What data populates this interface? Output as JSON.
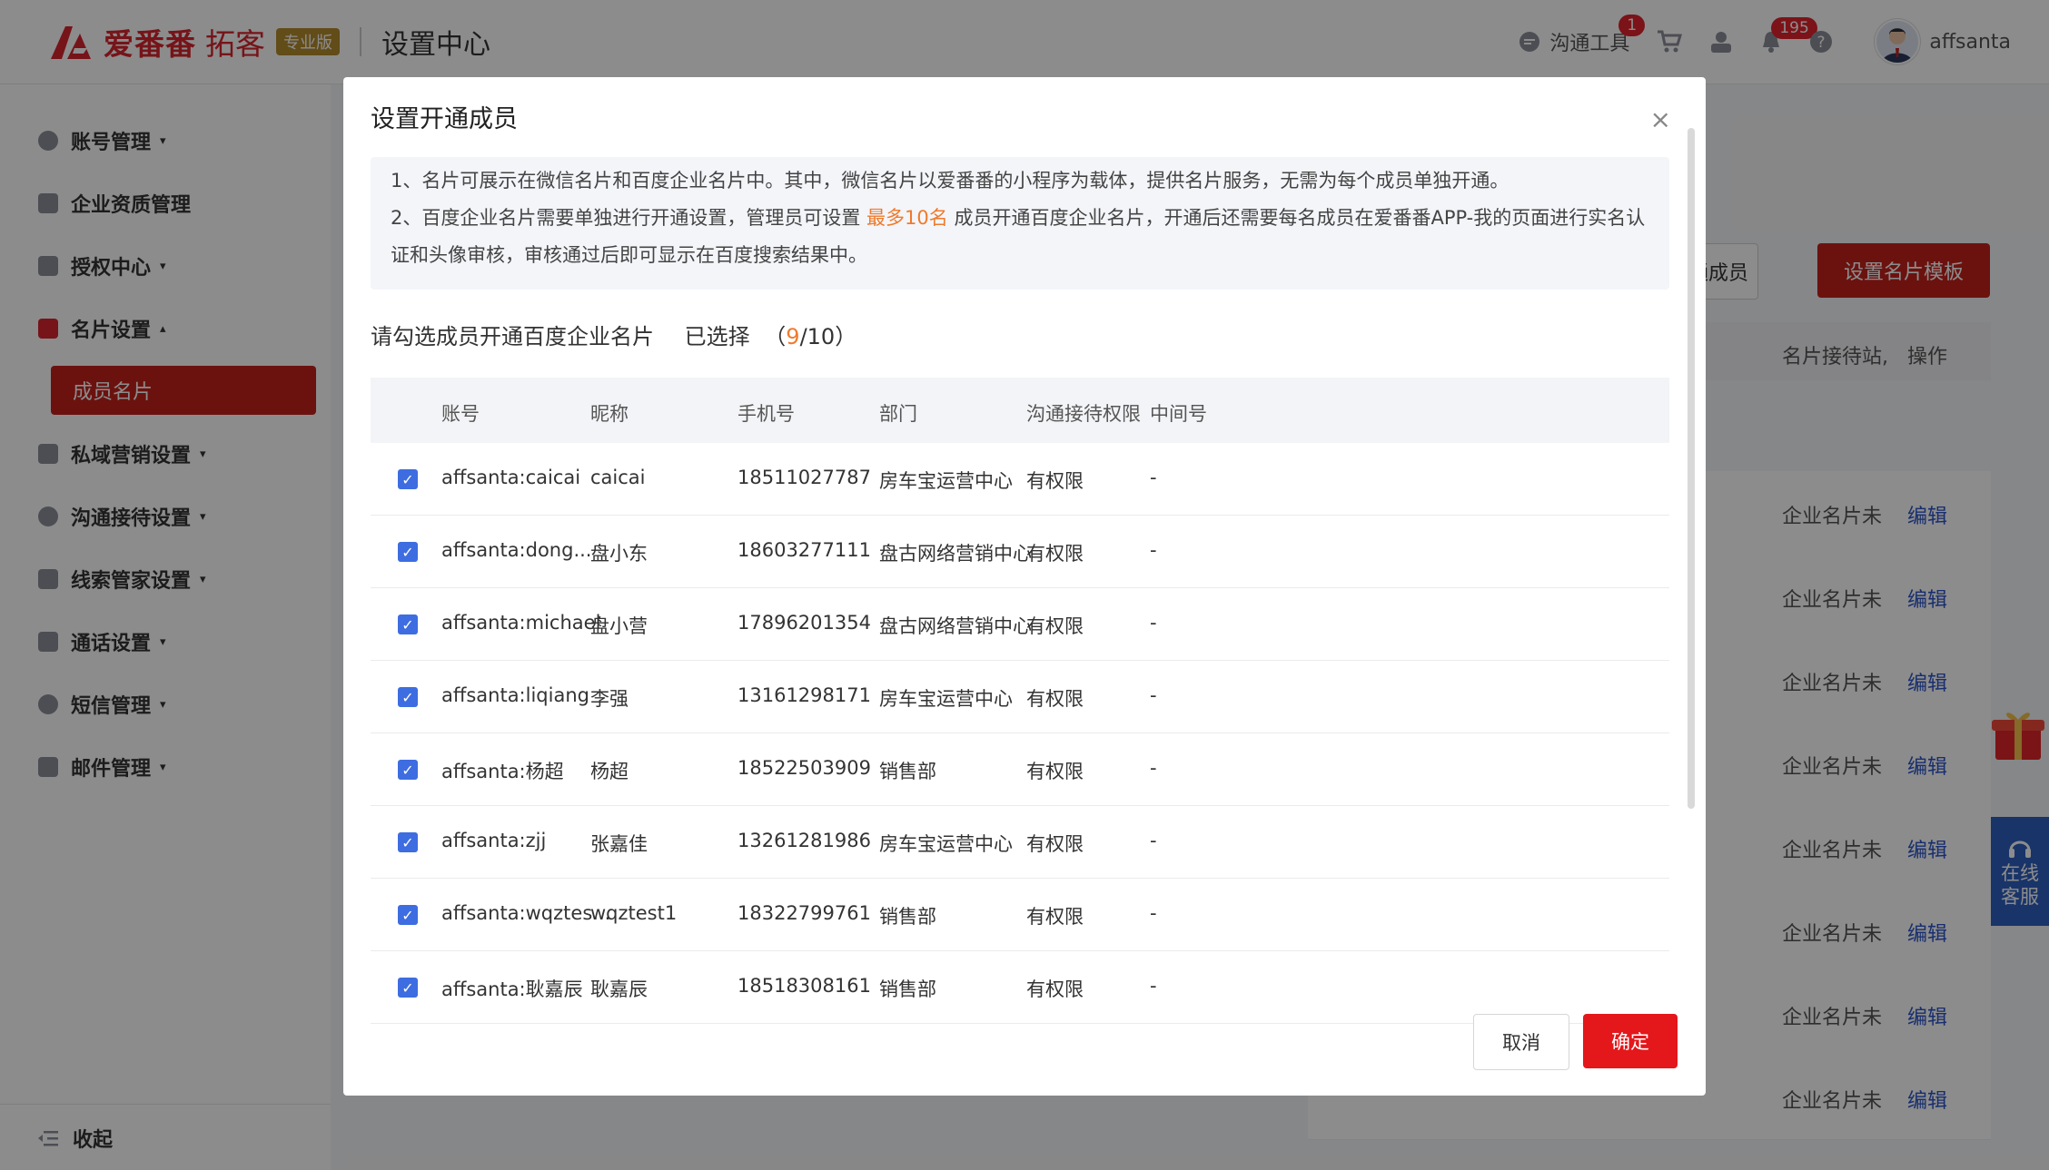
{
  "header": {
    "logo_text": "爱番番",
    "logo_text2": "拓客",
    "logo_badge": "专业版",
    "page_title": "设置中心",
    "comm_tool_label": "沟通工具",
    "comm_tool_badge": "1",
    "bell_badge": "195",
    "username": "affsanta"
  },
  "sidebar": {
    "items": [
      {
        "label": "账号管理",
        "icon": "user-circle-icon",
        "caret": "▾"
      },
      {
        "label": "企业资质管理",
        "icon": "document-icon",
        "caret": ""
      },
      {
        "label": "授权中心",
        "icon": "lock-icon",
        "caret": "▾"
      },
      {
        "label": "名片设置",
        "icon": "card-icon",
        "caret": "▴"
      },
      {
        "label": "私域营销设置",
        "icon": "chart-icon",
        "caret": "▾"
      },
      {
        "label": "沟通接待设置",
        "icon": "chat-icon",
        "caret": "▾"
      },
      {
        "label": "线索管家设置",
        "icon": "list-icon",
        "caret": "▾"
      },
      {
        "label": "通话设置",
        "icon": "phone-icon",
        "caret": "▾"
      },
      {
        "label": "短信管理",
        "icon": "message-icon",
        "caret": "▾"
      },
      {
        "label": "邮件管理",
        "icon": "mail-icon",
        "caret": "▾"
      }
    ],
    "active_sub": "成员名片",
    "collapse_label": "收起"
  },
  "background": {
    "btn_open_members": "通成员",
    "btn_template": "设置名片模板",
    "col_status": "名片接待站,",
    "col_ops": "操作",
    "row_status": "企业名片未",
    "row_edit": "编辑"
  },
  "float": {
    "online_service": "在线客服"
  },
  "modal": {
    "title": "设置开通成员",
    "notice1": "1、名片可展示在微信名片和百度企业名片中。其中，微信名片以爱番番的小程序为载体，提供名片服务，无需为每个成员单独开通。",
    "notice2a": "2、百度企业名片需要单独进行开通设置，管理员可设置 ",
    "notice2_hl": "最多10名",
    "notice2b": " 成员开通百度企业名片，开通后还需要每名成员在爱番番APP-我的页面进行实名认证和头像审核，审核通过后即可显示在百度搜索结果中。",
    "select_label": "请勾选成员开通百度企业名片",
    "selected_label": "已选择",
    "selected_count": "9",
    "selected_max": "/10",
    "columns": [
      "账号",
      "昵称",
      "手机号",
      "部门",
      "沟通接待权限",
      "中间号"
    ],
    "rows": [
      {
        "account": "affsanta:caicai",
        "nickname": "caicai",
        "phone": "18511027787",
        "dept": "房车宝运营中心",
        "perm": "有权限",
        "mid": "-"
      },
      {
        "account": "affsanta:dong...",
        "nickname": "盘小东",
        "phone": "18603277111",
        "dept": "盘古网络营销中心",
        "perm": "有权限",
        "mid": "-"
      },
      {
        "account": "affsanta:michael",
        "nickname": "盘小营",
        "phone": "17896201354",
        "dept": "盘古网络营销中心",
        "perm": "有权限",
        "mid": "-"
      },
      {
        "account": "affsanta:liqiang",
        "nickname": "李强",
        "phone": "13161298171",
        "dept": "房车宝运营中心",
        "perm": "有权限",
        "mid": "-"
      },
      {
        "account": "affsanta:杨超",
        "nickname": "杨超",
        "phone": "18522503909",
        "dept": "销售部",
        "perm": "有权限",
        "mid": "-"
      },
      {
        "account": "affsanta:zjj",
        "nickname": "张嘉佳",
        "phone": "13261281986",
        "dept": "房车宝运营中心",
        "perm": "有权限",
        "mid": "-"
      },
      {
        "account": "affsanta:wqztes...",
        "nickname": "wqztest1",
        "phone": "18322799761",
        "dept": "销售部",
        "perm": "有权限",
        "mid": "-"
      },
      {
        "account": "affsanta:耿嘉辰",
        "nickname": "耿嘉辰",
        "phone": "18518308161",
        "dept": "销售部",
        "perm": "有权限",
        "mid": "-"
      }
    ],
    "cancel_label": "取消",
    "ok_label": "确定",
    "close_symbol": "×"
  }
}
